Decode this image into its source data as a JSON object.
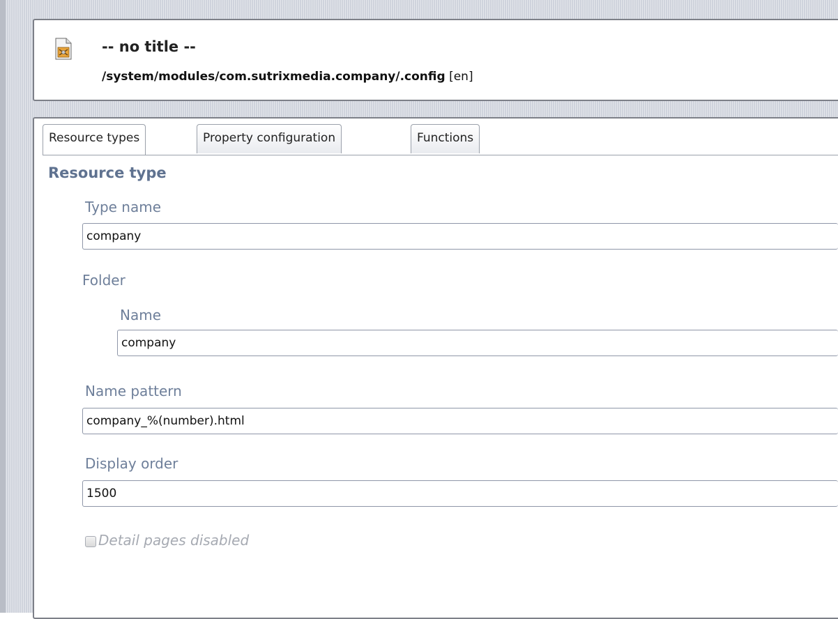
{
  "header": {
    "title": "-- no title --",
    "path": "/system/modules/com.sutrixmedia.company/.config",
    "locale": "[en]",
    "icon": "document-config-icon"
  },
  "tabs": [
    {
      "label": "Resource types",
      "active": true
    },
    {
      "label": "Property configuration",
      "active": false
    },
    {
      "label": "Functions",
      "active": false
    }
  ],
  "section": {
    "title": "Resource type"
  },
  "fields": {
    "type_name": {
      "label": "Type name",
      "value": "company"
    },
    "folder": {
      "label": "Folder"
    },
    "folder_name": {
      "label": "Name",
      "value": "company"
    },
    "name_pattern": {
      "label": "Name pattern",
      "value": "company_%(number).html"
    },
    "display_order": {
      "label": "Display order",
      "value": "1500"
    }
  },
  "checkbox": {
    "label": "Detail pages disabled",
    "checked": false
  },
  "colors": {
    "section_title": "#5f7290",
    "field_label": "#6e7f9a",
    "panel_border": "#7d8088"
  }
}
